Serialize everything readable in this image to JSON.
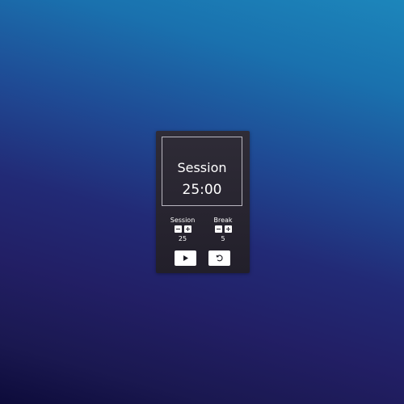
{
  "timer": {
    "mode": "Session",
    "time": "25:00"
  },
  "session": {
    "label": "Session",
    "value": "25"
  },
  "break": {
    "label": "Break",
    "value": "5"
  },
  "icons": {
    "decrement": "minus-icon",
    "increment": "plus-icon",
    "play": "play-icon",
    "reset": "reset-icon"
  },
  "colors": {
    "card": "#2b2833",
    "text": "#ffffff",
    "buttons": "#ffffff"
  }
}
